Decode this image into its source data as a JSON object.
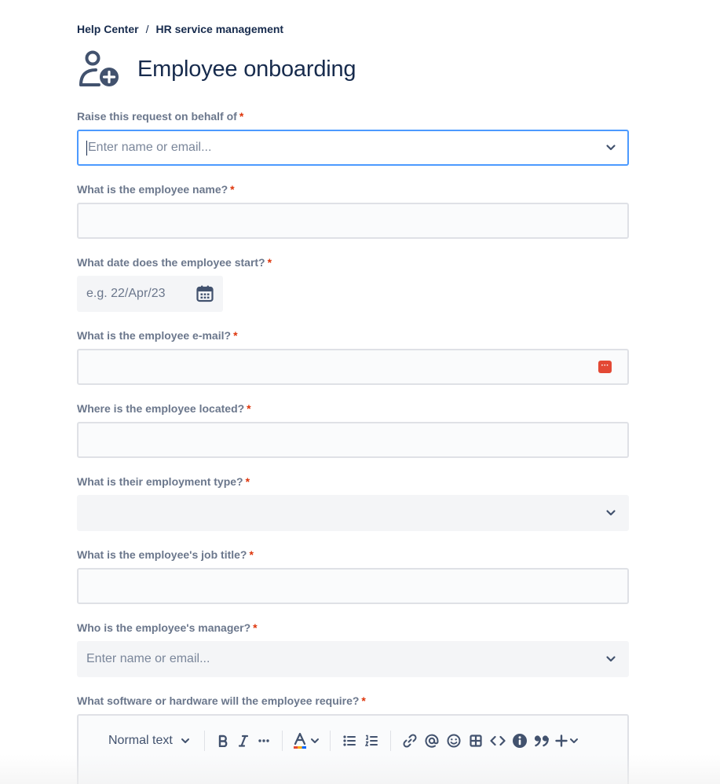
{
  "breadcrumb": {
    "home": "Help Center",
    "separator": "/",
    "current": "HR service management"
  },
  "header": {
    "title": "Employee onboarding",
    "icon": "person-add-icon"
  },
  "form": {
    "required_mark": "*",
    "on_behalf": {
      "label": "Raise this request on behalf of",
      "placeholder": "Enter name or email..."
    },
    "employee_name": {
      "label": "What is the employee name?",
      "value": ""
    },
    "start_date": {
      "label": "What date does the employee start?",
      "placeholder": "e.g. 22/Apr/23"
    },
    "employee_email": {
      "label": "What is the employee e-mail?",
      "value": ""
    },
    "location": {
      "label": "Where is the employee located?",
      "value": ""
    },
    "employment_type": {
      "label": "What is their employment type?",
      "selected": ""
    },
    "job_title": {
      "label": "What is the employee's job title?",
      "value": ""
    },
    "manager": {
      "label": "Who is the employee's manager?",
      "placeholder": "Enter name or email..."
    },
    "software_hardware": {
      "label": "What software or hardware will the employee require?",
      "toolbar": {
        "text_style": "Normal text"
      }
    }
  },
  "colors": {
    "text": "#172b4d",
    "label": "#6b778c",
    "required": "#de350b",
    "focus_border": "#4c9aff",
    "field_border": "#dfe1e6",
    "field_bg": "#fafbfc",
    "filled_bg": "#f4f5f7",
    "extension_icon": "#e34935"
  }
}
